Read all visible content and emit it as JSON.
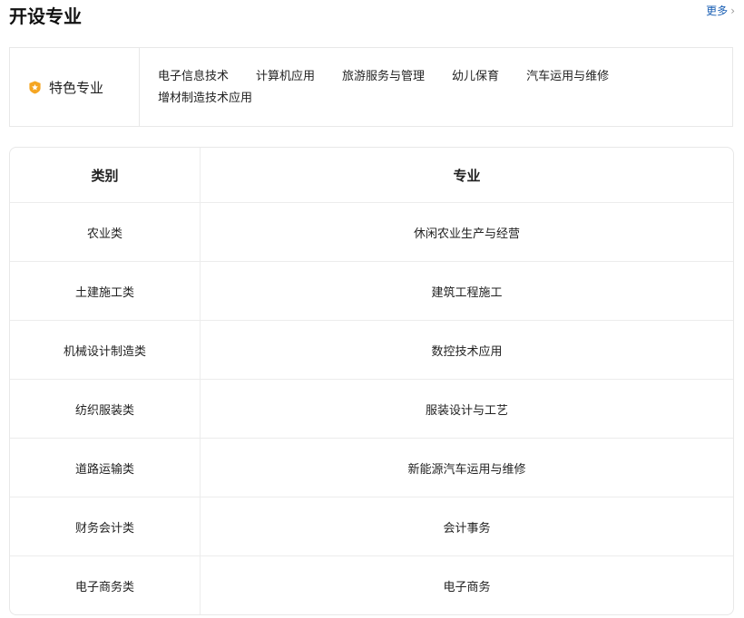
{
  "header": {
    "title": "开设专业",
    "more_label": "更多",
    "more_icon": "chevron-right-icon"
  },
  "featured": {
    "label": "特色专业",
    "icon": "star-badge-icon",
    "icon_color": "#f5a623",
    "items": [
      "电子信息技术",
      "计算机应用",
      "旅游服务与管理",
      "幼儿保育",
      "汽车运用与维修",
      "增材制造技术应用"
    ]
  },
  "table": {
    "headers": {
      "category": "类别",
      "major": "专业"
    },
    "rows": [
      {
        "category": "农业类",
        "major": "休闲农业生产与经营"
      },
      {
        "category": "土建施工类",
        "major": "建筑工程施工"
      },
      {
        "category": "机械设计制造类",
        "major": "数控技术应用"
      },
      {
        "category": "纺织服装类",
        "major": "服装设计与工艺"
      },
      {
        "category": "道路运输类",
        "major": "新能源汽车运用与维修"
      },
      {
        "category": "财务会计类",
        "major": "会计事务"
      },
      {
        "category": "电子商务类",
        "major": "电子商务"
      }
    ]
  },
  "colors": {
    "link": "#1a5fb4",
    "border": "#e8e8e8"
  }
}
